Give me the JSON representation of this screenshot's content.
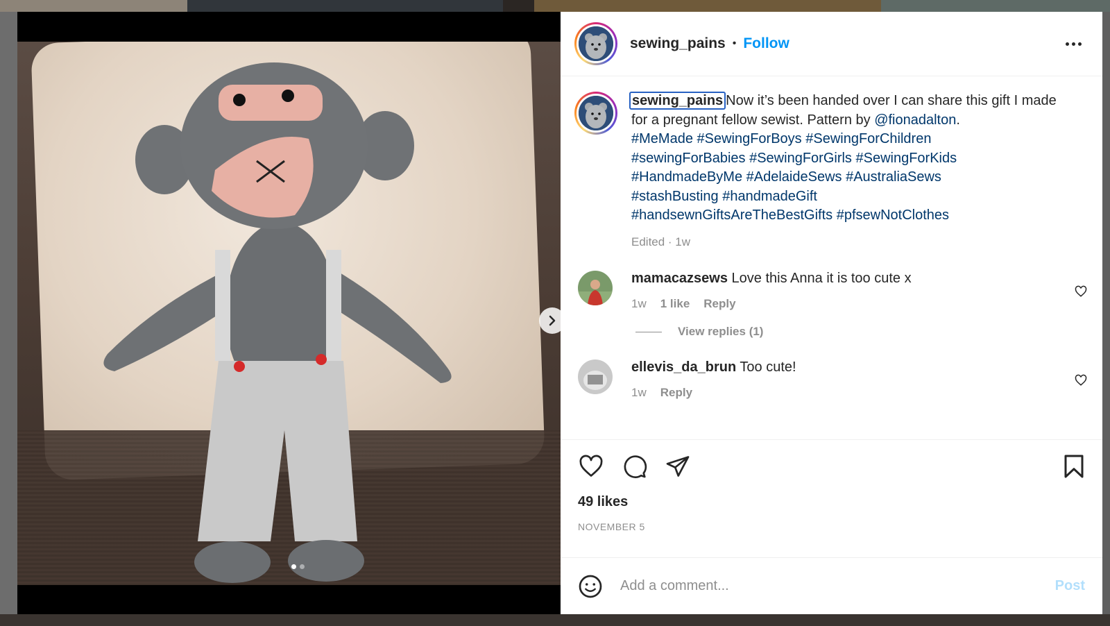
{
  "post": {
    "username": "sewing_pains",
    "separator": "•",
    "follow_label": "Follow",
    "more_icon": "more-options-icon",
    "caption": {
      "username": "sewing_pains",
      "text_1": "Now it’s been handed over I can share this gift I made for a pregnant fellow sewist. Pattern by ",
      "mention": "@fionadalton",
      "text_2": ".",
      "hashtags": [
        "#MeMade",
        "#SewingForBoys",
        "#SewingForChildren",
        "#sewingForBabies",
        "#SewingForGirls",
        "#SewingForKids",
        "#HandmadeByMe",
        "#AdelaideSews",
        "#AustraliaSews",
        "#stashBusting",
        "#handmadeGift",
        "#handsewnGiftsAreTheBestGifts",
        "#pfsewNotClothes"
      ],
      "meta": "Edited · 1w"
    },
    "comments": [
      {
        "username": "mamacazsews",
        "text": "Love this Anna it is too cute x",
        "time": "1w",
        "likes": "1 like",
        "reply": "Reply",
        "view_replies": "View replies (1)"
      },
      {
        "username": "ellevis_da_brun",
        "text": "Too cute!",
        "time": "1w",
        "reply": "Reply"
      }
    ],
    "likes": "49 likes",
    "date": "NOVEMBER 5",
    "comment_placeholder": "Add a comment...",
    "post_label": "Post",
    "carousel": {
      "current": 1,
      "total": 2
    }
  },
  "colors": {
    "accent": "#0095f6",
    "link": "#00376b",
    "muted": "#8e8e8e",
    "text": "#262626",
    "post_disabled": "#b2dffc"
  }
}
